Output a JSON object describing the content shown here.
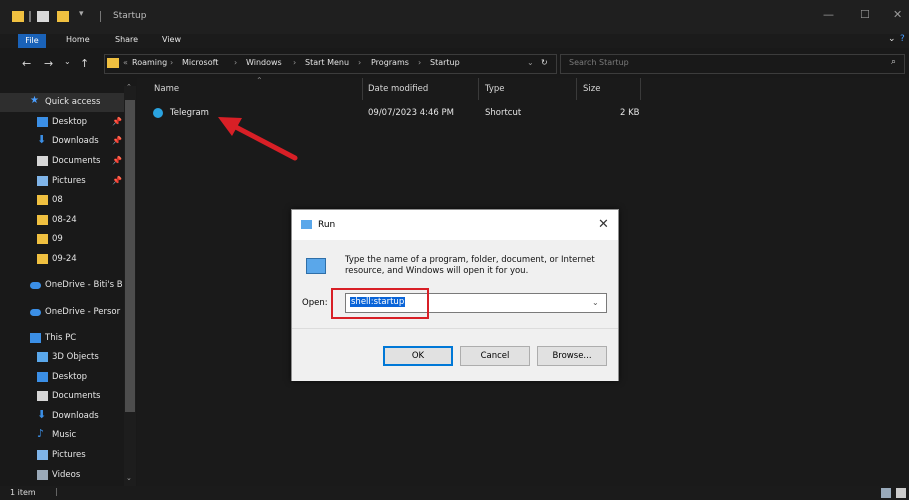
{
  "window": {
    "title": "Startup",
    "controls": [
      "—",
      "☐",
      "✕"
    ]
  },
  "ribbon": {
    "tabs": [
      "File",
      "Home",
      "Share",
      "View"
    ]
  },
  "address": {
    "crumbs": [
      "Roaming",
      "Microsoft",
      "Windows",
      "Start Menu",
      "Programs",
      "Startup"
    ],
    "search_placeholder": "Search Startup"
  },
  "nav": {
    "items": [
      {
        "label": "Quick access",
        "icon": "star-icon",
        "pinned": false
      },
      {
        "label": "Desktop",
        "icon": "desktop-folder-icon",
        "pinned": true
      },
      {
        "label": "Downloads",
        "icon": "download-icon",
        "pinned": true
      },
      {
        "label": "Documents",
        "icon": "document-icon",
        "pinned": true
      },
      {
        "label": "Pictures",
        "icon": "pictures-icon",
        "pinned": true
      },
      {
        "label": "08",
        "icon": "folder-icon",
        "pinned": false
      },
      {
        "label": "08-24",
        "icon": "folder-icon",
        "pinned": false
      },
      {
        "label": "09",
        "icon": "folder-icon",
        "pinned": false
      },
      {
        "label": "09-24",
        "icon": "folder-icon",
        "pinned": false
      },
      {
        "label": "OneDrive - Biti's B",
        "icon": "cloud-icon",
        "pinned": false
      },
      {
        "label": "OneDrive - Persor",
        "icon": "cloud-icon",
        "pinned": false
      },
      {
        "label": "This PC",
        "icon": "pc-icon",
        "pinned": false
      },
      {
        "label": "3D Objects",
        "icon": "cube-icon",
        "pinned": false
      },
      {
        "label": "Desktop",
        "icon": "desktop-folder-icon",
        "pinned": false
      },
      {
        "label": "Documents",
        "icon": "document-icon",
        "pinned": false
      },
      {
        "label": "Downloads",
        "icon": "download-icon",
        "pinned": false
      },
      {
        "label": "Music",
        "icon": "music-icon",
        "pinned": false
      },
      {
        "label": "Pictures",
        "icon": "pictures-icon",
        "pinned": false
      },
      {
        "label": "Videos",
        "icon": "video-icon",
        "pinned": false
      }
    ]
  },
  "columns": {
    "name": "Name",
    "date": "Date modified",
    "type": "Type",
    "size": "Size"
  },
  "files": [
    {
      "name": "Telegram",
      "date": "09/07/2023 4:46 PM",
      "type": "Shortcut",
      "size": "2 KB"
    }
  ],
  "status": {
    "count": "1 item"
  },
  "run_dialog": {
    "title": "Run",
    "description": "Type the name of a program, folder, document, or Internet resource, and Windows will open it for you.",
    "open_label": "Open:",
    "input_value": "shell:startup",
    "ok": "OK",
    "cancel": "Cancel",
    "browse": "Browse..."
  },
  "colors": {
    "accent": "#1a62b8",
    "highlight": "#d81f26",
    "folder": "#f0c040"
  }
}
